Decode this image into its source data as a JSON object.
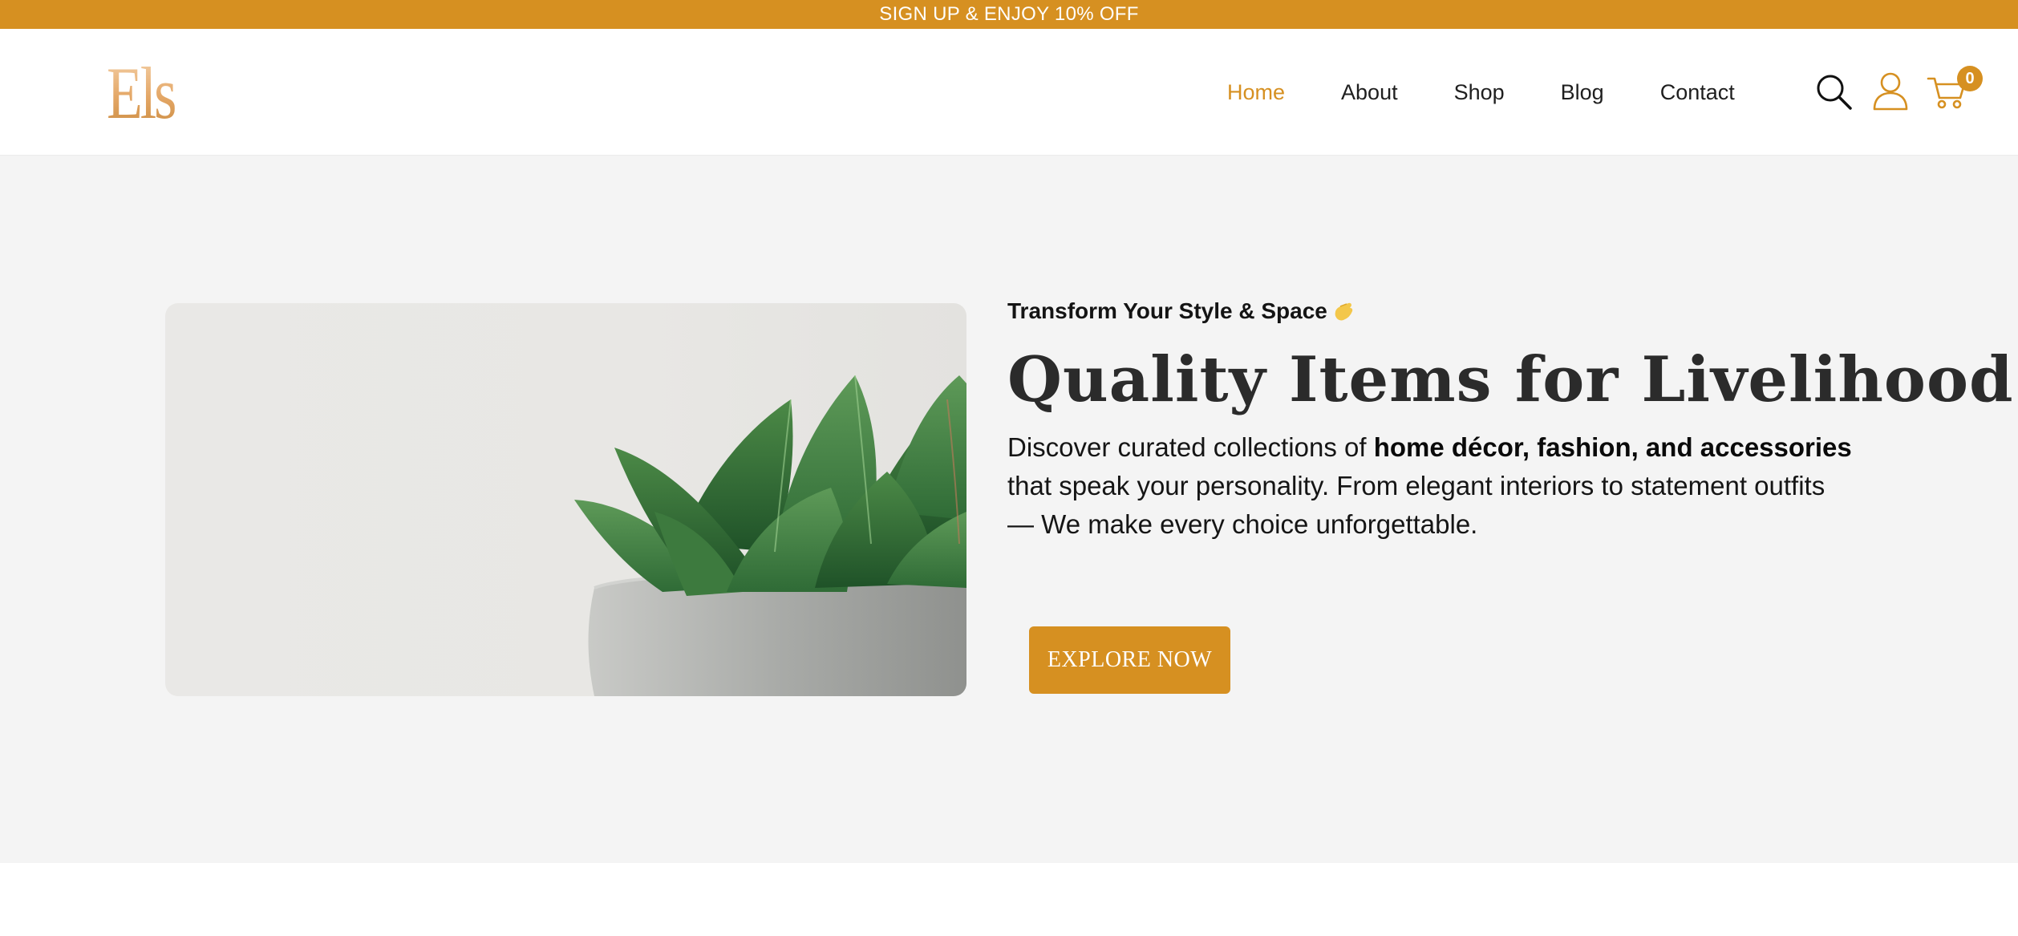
{
  "promo": {
    "text": "SIGN UP & ENJOY 10% OFF"
  },
  "header": {
    "logo_text": "Els",
    "nav": [
      {
        "label": "Home",
        "active": true
      },
      {
        "label": "About"
      },
      {
        "label": "Shop"
      },
      {
        "label": "Blog"
      },
      {
        "label": "Contact"
      }
    ],
    "icons": [
      "search-icon",
      "user-icon",
      "cart-icon"
    ],
    "cart_count": "0"
  },
  "hero": {
    "eyebrow": "Transform Your Style & Space",
    "eyebrow_icon": "waving-hand-icon",
    "headline": "Quality Items for Livelihood",
    "body_pre": "Discover curated collections of ",
    "body_bold": "home décor, fashion, and accessories",
    "body_post": " that speak your personality. From elegant interiors to statement outfits — We make every choice unforgettable.",
    "cta_label": "EXPLORE NOW",
    "image_subject": "succulent-plant-in-concrete-pot"
  },
  "colors": {
    "accent": "#d69021",
    "hero_bg": "#f4f4f4",
    "text_dark": "#1f1f1f"
  }
}
